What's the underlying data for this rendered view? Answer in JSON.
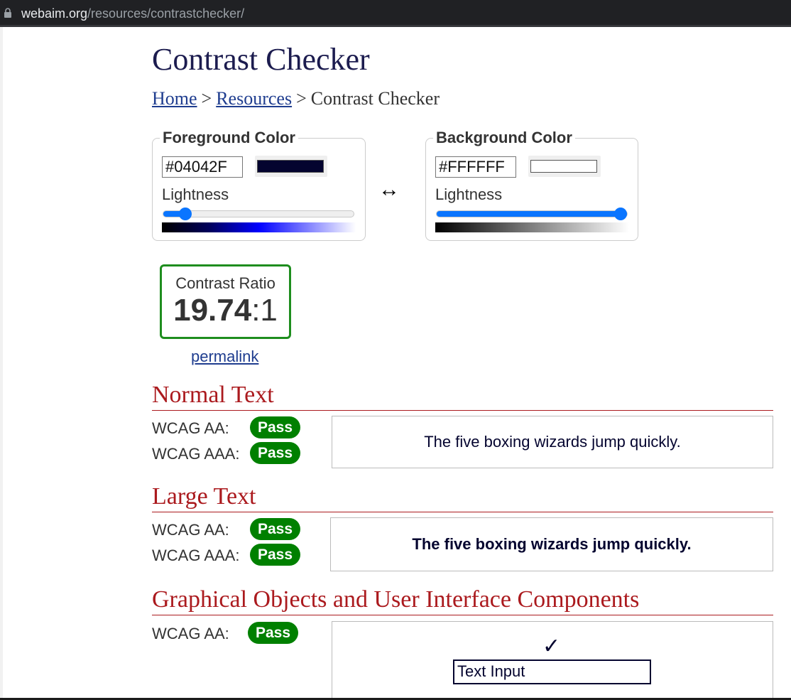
{
  "browser": {
    "url_host": "webaim.org",
    "url_path": "/resources/contrastchecker/"
  },
  "page": {
    "title": "Contrast Checker",
    "breadcrumb": {
      "items": [
        "Home",
        "Resources"
      ],
      "separator": ">",
      "current": "Contrast Checker"
    }
  },
  "foreground": {
    "legend": "Foreground Color",
    "hex_value": "#04042F",
    "swatch_color": "#04042F",
    "lightness_label": "Lightness",
    "lightness_percent": 10
  },
  "swap_icon": "↔",
  "background": {
    "legend": "Background Color",
    "hex_value": "#FFFFFF",
    "swatch_color": "#FFFFFF",
    "lightness_label": "Lightness",
    "lightness_percent": 100
  },
  "contrast": {
    "label": "Contrast Ratio",
    "ratio_bold": "19.74",
    "ratio_rest": ":1",
    "permalink": "permalink"
  },
  "sections": {
    "normal": {
      "title": "Normal Text",
      "aa_label": "WCAG AA:",
      "aa_result": "Pass",
      "aaa_label": "WCAG AAA:",
      "aaa_result": "Pass",
      "sample": "The five boxing wizards jump quickly."
    },
    "large": {
      "title": "Large Text",
      "aa_label": "WCAG AA:",
      "aa_result": "Pass",
      "aaa_label": "WCAG AAA:",
      "aaa_result": "Pass",
      "sample": "The five boxing wizards jump quickly."
    },
    "graphical": {
      "title": "Graphical Objects and User Interface Components",
      "aa_label": "WCAG AA:",
      "aa_result": "Pass",
      "check_icon": "✓",
      "input_text": "Text Input"
    }
  },
  "colors": {
    "pass": "#008000",
    "section_heading": "#ab1a1e",
    "link": "#1f3d8f",
    "ratio_border": "#1e8d1e",
    "slider_accent": "#0a75ff"
  }
}
